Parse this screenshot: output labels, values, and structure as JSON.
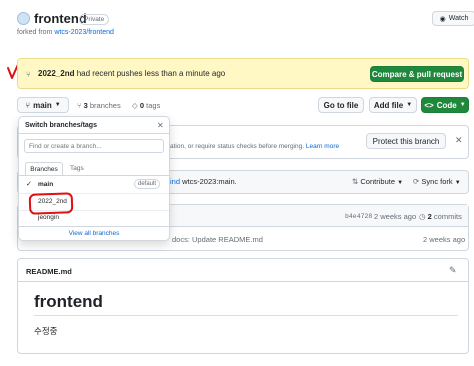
{
  "repo": {
    "name": "frontend",
    "visibility": "Private",
    "forked_prefix": "forked from",
    "forked_source": "wtcs-2023/frontend",
    "watch_label": "Watch"
  },
  "banner": {
    "branch": "2022_2nd",
    "message": "had recent pushes less than a minute ago",
    "compare_button": "Compare & pull request"
  },
  "toolbar": {
    "branch_button": "main",
    "branches_count": "3",
    "branches_label": "branches",
    "tags_count": "0",
    "tags_label": "tags",
    "goto_file": "Go to file",
    "add_file": "Add file",
    "code_button": "Code"
  },
  "protect": {
    "text_line1": "ation, or require status checks before merging.",
    "learn_more": "Learn more",
    "button": "Protect this branch"
  },
  "fork_bar": {
    "text_link": "ind",
    "text": "wtcs-2023:main.",
    "contribute": "Contribute",
    "sync_fork": "Sync fork"
  },
  "commit_bar": {
    "hash": "b4e4728",
    "time": "2 weeks ago",
    "count": "2",
    "count_label": "commits"
  },
  "file_row": {
    "message": "docs: Update README.md",
    "time": "2 weeks ago"
  },
  "dropdown": {
    "title": "Switch branches/tags",
    "filter_placeholder": "Find or create a branch...",
    "tab_branches": "Branches",
    "tab_tags": "Tags",
    "items": [
      {
        "name": "main",
        "badge": "default"
      },
      {
        "name": "2022_2nd",
        "badge": ""
      },
      {
        "name": "jeongin",
        "badge": ""
      }
    ],
    "view_all": "View all branches"
  },
  "readme": {
    "filename": "README.md",
    "heading": "frontend",
    "body": "수정중"
  },
  "colors": {
    "accent_green": "#1f883d",
    "link_blue": "#0969da",
    "banner_bg": "#fff8c5",
    "annotation_red": "#e01010"
  }
}
